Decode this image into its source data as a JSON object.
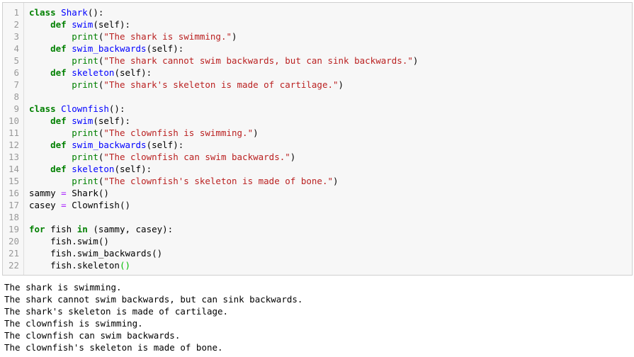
{
  "code_cell": {
    "lines": [
      {
        "n": "1",
        "tokens": [
          {
            "t": "class",
            "c": "kw"
          },
          {
            "t": " "
          },
          {
            "t": "Shark",
            "c": "def"
          },
          {
            "t": "():"
          }
        ]
      },
      {
        "n": "2",
        "tokens": [
          {
            "t": "    "
          },
          {
            "t": "def",
            "c": "kw"
          },
          {
            "t": " "
          },
          {
            "t": "swim",
            "c": "def"
          },
          {
            "t": "(self):"
          }
        ]
      },
      {
        "n": "3",
        "tokens": [
          {
            "t": "        "
          },
          {
            "t": "print",
            "c": "bi"
          },
          {
            "t": "("
          },
          {
            "t": "\"The shark is swimming.\"",
            "c": "str"
          },
          {
            "t": ")"
          }
        ]
      },
      {
        "n": "4",
        "tokens": [
          {
            "t": "    "
          },
          {
            "t": "def",
            "c": "kw"
          },
          {
            "t": " "
          },
          {
            "t": "swim_backwards",
            "c": "def"
          },
          {
            "t": "(self):"
          }
        ]
      },
      {
        "n": "5",
        "tokens": [
          {
            "t": "        "
          },
          {
            "t": "print",
            "c": "bi"
          },
          {
            "t": "("
          },
          {
            "t": "\"The shark cannot swim backwards, but can sink backwards.\"",
            "c": "str"
          },
          {
            "t": ")"
          }
        ]
      },
      {
        "n": "6",
        "tokens": [
          {
            "t": "    "
          },
          {
            "t": "def",
            "c": "kw"
          },
          {
            "t": " "
          },
          {
            "t": "skeleton",
            "c": "def"
          },
          {
            "t": "(self):"
          }
        ]
      },
      {
        "n": "7",
        "tokens": [
          {
            "t": "        "
          },
          {
            "t": "print",
            "c": "bi"
          },
          {
            "t": "("
          },
          {
            "t": "\"The shark's skeleton is made of cartilage.\"",
            "c": "str"
          },
          {
            "t": ")"
          }
        ]
      },
      {
        "n": "8",
        "tokens": []
      },
      {
        "n": "9",
        "tokens": [
          {
            "t": "class",
            "c": "kw"
          },
          {
            "t": " "
          },
          {
            "t": "Clownfish",
            "c": "def"
          },
          {
            "t": "():"
          }
        ]
      },
      {
        "n": "10",
        "tokens": [
          {
            "t": "    "
          },
          {
            "t": "def",
            "c": "kw"
          },
          {
            "t": " "
          },
          {
            "t": "swim",
            "c": "def"
          },
          {
            "t": "(self):"
          }
        ]
      },
      {
        "n": "11",
        "tokens": [
          {
            "t": "        "
          },
          {
            "t": "print",
            "c": "bi"
          },
          {
            "t": "("
          },
          {
            "t": "\"The clownfish is swimming.\"",
            "c": "str"
          },
          {
            "t": ")"
          }
        ]
      },
      {
        "n": "12",
        "tokens": [
          {
            "t": "    "
          },
          {
            "t": "def",
            "c": "kw"
          },
          {
            "t": " "
          },
          {
            "t": "swim_backwards",
            "c": "def"
          },
          {
            "t": "(self):"
          }
        ]
      },
      {
        "n": "13",
        "tokens": [
          {
            "t": "        "
          },
          {
            "t": "print",
            "c": "bi"
          },
          {
            "t": "("
          },
          {
            "t": "\"The clownfish can swim backwards.\"",
            "c": "str"
          },
          {
            "t": ")"
          }
        ]
      },
      {
        "n": "14",
        "tokens": [
          {
            "t": "    "
          },
          {
            "t": "def",
            "c": "kw"
          },
          {
            "t": " "
          },
          {
            "t": "skeleton",
            "c": "def"
          },
          {
            "t": "(self):"
          }
        ]
      },
      {
        "n": "15",
        "tokens": [
          {
            "t": "        "
          },
          {
            "t": "print",
            "c": "bi"
          },
          {
            "t": "("
          },
          {
            "t": "\"The clownfish's skeleton is made of bone.\"",
            "c": "str"
          },
          {
            "t": ")"
          }
        ]
      },
      {
        "n": "16",
        "tokens": [
          {
            "t": "sammy "
          },
          {
            "t": "=",
            "c": "op"
          },
          {
            "t": " Shark()"
          }
        ]
      },
      {
        "n": "17",
        "tokens": [
          {
            "t": "casey "
          },
          {
            "t": "=",
            "c": "op"
          },
          {
            "t": " Clownfish()"
          }
        ]
      },
      {
        "n": "18",
        "tokens": []
      },
      {
        "n": "19",
        "tokens": [
          {
            "t": "for",
            "c": "kw"
          },
          {
            "t": " fish "
          },
          {
            "t": "in",
            "c": "kw"
          },
          {
            "t": " (sammy, casey):"
          }
        ]
      },
      {
        "n": "20",
        "tokens": [
          {
            "t": "    fish.swim()"
          }
        ]
      },
      {
        "n": "21",
        "tokens": [
          {
            "t": "    fish.swim_backwards()"
          }
        ]
      },
      {
        "n": "22",
        "tokens": [
          {
            "t": "    fish.skeleton"
          },
          {
            "t": "()",
            "c": "hl"
          }
        ]
      }
    ]
  },
  "output": {
    "lines": [
      "The shark is swimming.",
      "The shark cannot swim backwards, but can sink backwards.",
      "The shark's skeleton is made of cartilage.",
      "The clownfish is swimming.",
      "The clownfish can swim backwards.",
      "The clownfish's skeleton is made of bone."
    ]
  },
  "colors": {
    "cell_background": "#f7f7f7",
    "cell_border": "#cfcfcf",
    "keyword": "#008000",
    "definition": "#0000ff",
    "string": "#ba2121",
    "operator": "#aa22ff",
    "line_number": "#999999"
  }
}
